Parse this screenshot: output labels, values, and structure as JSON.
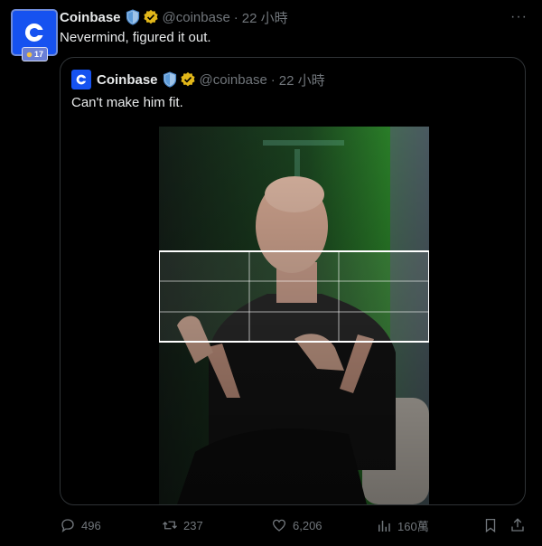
{
  "tweet": {
    "author_name": "Coinbase",
    "handle": "@coinbase",
    "separator": "·",
    "time": "22 小時",
    "more": "···",
    "text": "Nevermind, figured it out.",
    "avatar_badge": "17"
  },
  "quoted": {
    "author_name": "Coinbase",
    "handle": "@coinbase",
    "separator": "·",
    "time": "22 小時",
    "text": "Can't make him fit."
  },
  "actions": {
    "replies": "496",
    "reposts": "237",
    "likes": "6,206",
    "views": "160萬"
  },
  "colors": {
    "background": "#000000",
    "brand": "#1652f0",
    "muted": "#71767b",
    "verified_gold": "#e2b719",
    "border": "#2f3336"
  },
  "icons": [
    "coinbase-logo-icon",
    "shield-icon",
    "verified-badge-icon",
    "more-icon",
    "reply-icon",
    "repost-icon",
    "like-icon",
    "views-icon",
    "bookmark-icon",
    "share-icon"
  ]
}
